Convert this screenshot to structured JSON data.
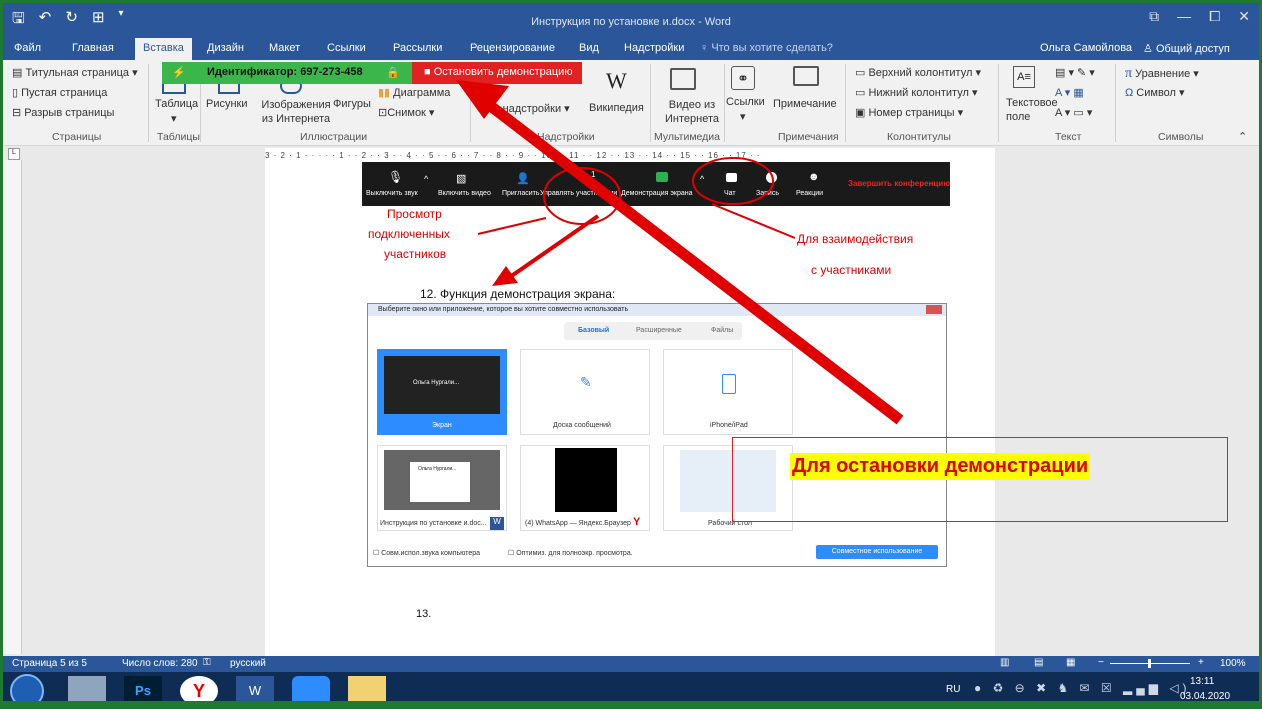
{
  "window": {
    "title": "Инструкция по установке и.docx - Word"
  },
  "tabs": [
    {
      "label": "Файл"
    },
    {
      "label": "Главная"
    },
    {
      "label": "Вставка"
    },
    {
      "label": "Дизайн"
    },
    {
      "label": "Макет"
    },
    {
      "label": "Ссылки"
    },
    {
      "label": "Рассылки"
    },
    {
      "label": "Рецензирование"
    },
    {
      "label": "Вид"
    },
    {
      "label": "Надстройки"
    }
  ],
  "tell_me": "Что вы хотите сделать?",
  "user": {
    "name": "Ольга Самойлова",
    "share": "Общий доступ"
  },
  "ribbon": {
    "pages": {
      "cover": "Титульная страница",
      "blank": "Пустая страница",
      "break": "Разрыв страницы",
      "group": "Страницы"
    },
    "tables": {
      "table": "Таблица",
      "group": "Таблицы"
    },
    "illustrations": {
      "pictures": "Рисунки",
      "online_pictures": "Изображения из Интернета",
      "shapes": "Фигуры",
      "chart": "Диаграмма",
      "screenshot": "Снимок",
      "group": "Иллюстрации"
    },
    "addins": {
      "my_addins": "Мои надстройки",
      "wikipedia": "Википедия",
      "group": "Надстройки"
    },
    "media": {
      "video": "Видео из Интернета",
      "group": "Мультимедиа"
    },
    "links": {
      "links": "Ссылки"
    },
    "comments": {
      "comment": "Примечание",
      "group": "Примечания"
    },
    "header_footer": {
      "header": "Верхний колонтитул",
      "footer": "Нижний колонтитул",
      "page_number": "Номер страницы",
      "group": "Колонтитулы"
    },
    "text": {
      "textbox": "Текстовое поле",
      "group": "Текст"
    },
    "symbols": {
      "equation": "Уравнение",
      "symbol": "Символ",
      "group": "Символы"
    }
  },
  "zoom_bar": {
    "meeting_id": "Идентификатор: 697-273-458",
    "stop_share": "Остановить демонстрацию"
  },
  "zoom_toolbar": {
    "mute": "Выключить звук",
    "video": "Включить видео",
    "invite": "Пригласить",
    "participants": "Управлять участниками",
    "participants_count": "1",
    "share": "Демонстрация экрана",
    "chat": "Чат",
    "record": "Запись",
    "reactions": "Реакции",
    "end": "Завершить конференцию"
  },
  "annotations": {
    "view_participants": [
      "Просмотр",
      "подключенных",
      "участников"
    ],
    "interaction": [
      "Для взаимодействия",
      "с участниками"
    ]
  },
  "doc": {
    "item12": "12. Функция демонстрация экрана:",
    "item13": "13."
  },
  "share_dialog": {
    "title": "Выберите окно или приложение, которое вы хотите совместно использовать",
    "tabs": [
      "Базовый",
      "Расширенные",
      "Файлы"
    ],
    "tiles": [
      {
        "label": "Экран",
        "inner": "Ольга Нургали..."
      },
      {
        "label": "Доска сообщений"
      },
      {
        "label": "iPhone/iPad"
      },
      {
        "label": "Инструкция по установке и.doc...",
        "inner": "Ольга Нургали..."
      },
      {
        "label": "(4) WhatsApp — Яндекс.Браузер"
      },
      {
        "label": "Рабочий стол"
      }
    ],
    "checkbox1": "Совм.испол.звука компьютера",
    "checkbox2": "Оптимиз. для полноэкр. просмотра.",
    "button": "Совместное использование"
  },
  "callout": "Для остановки демонстрации",
  "status": {
    "page": "Страница 5 из 5",
    "words": "Число слов: 280",
    "lang": "русский",
    "zoom": "100%"
  },
  "taskbar": {
    "lang": "RU",
    "time": "13:11",
    "date": "03.04.2020"
  },
  "colors": {
    "word_blue": "#2b579a",
    "zoom_green": "#3bb64a",
    "zoom_red": "#e02222",
    "annotation_red": "#e00000",
    "callout_bg": "#ffff00"
  }
}
